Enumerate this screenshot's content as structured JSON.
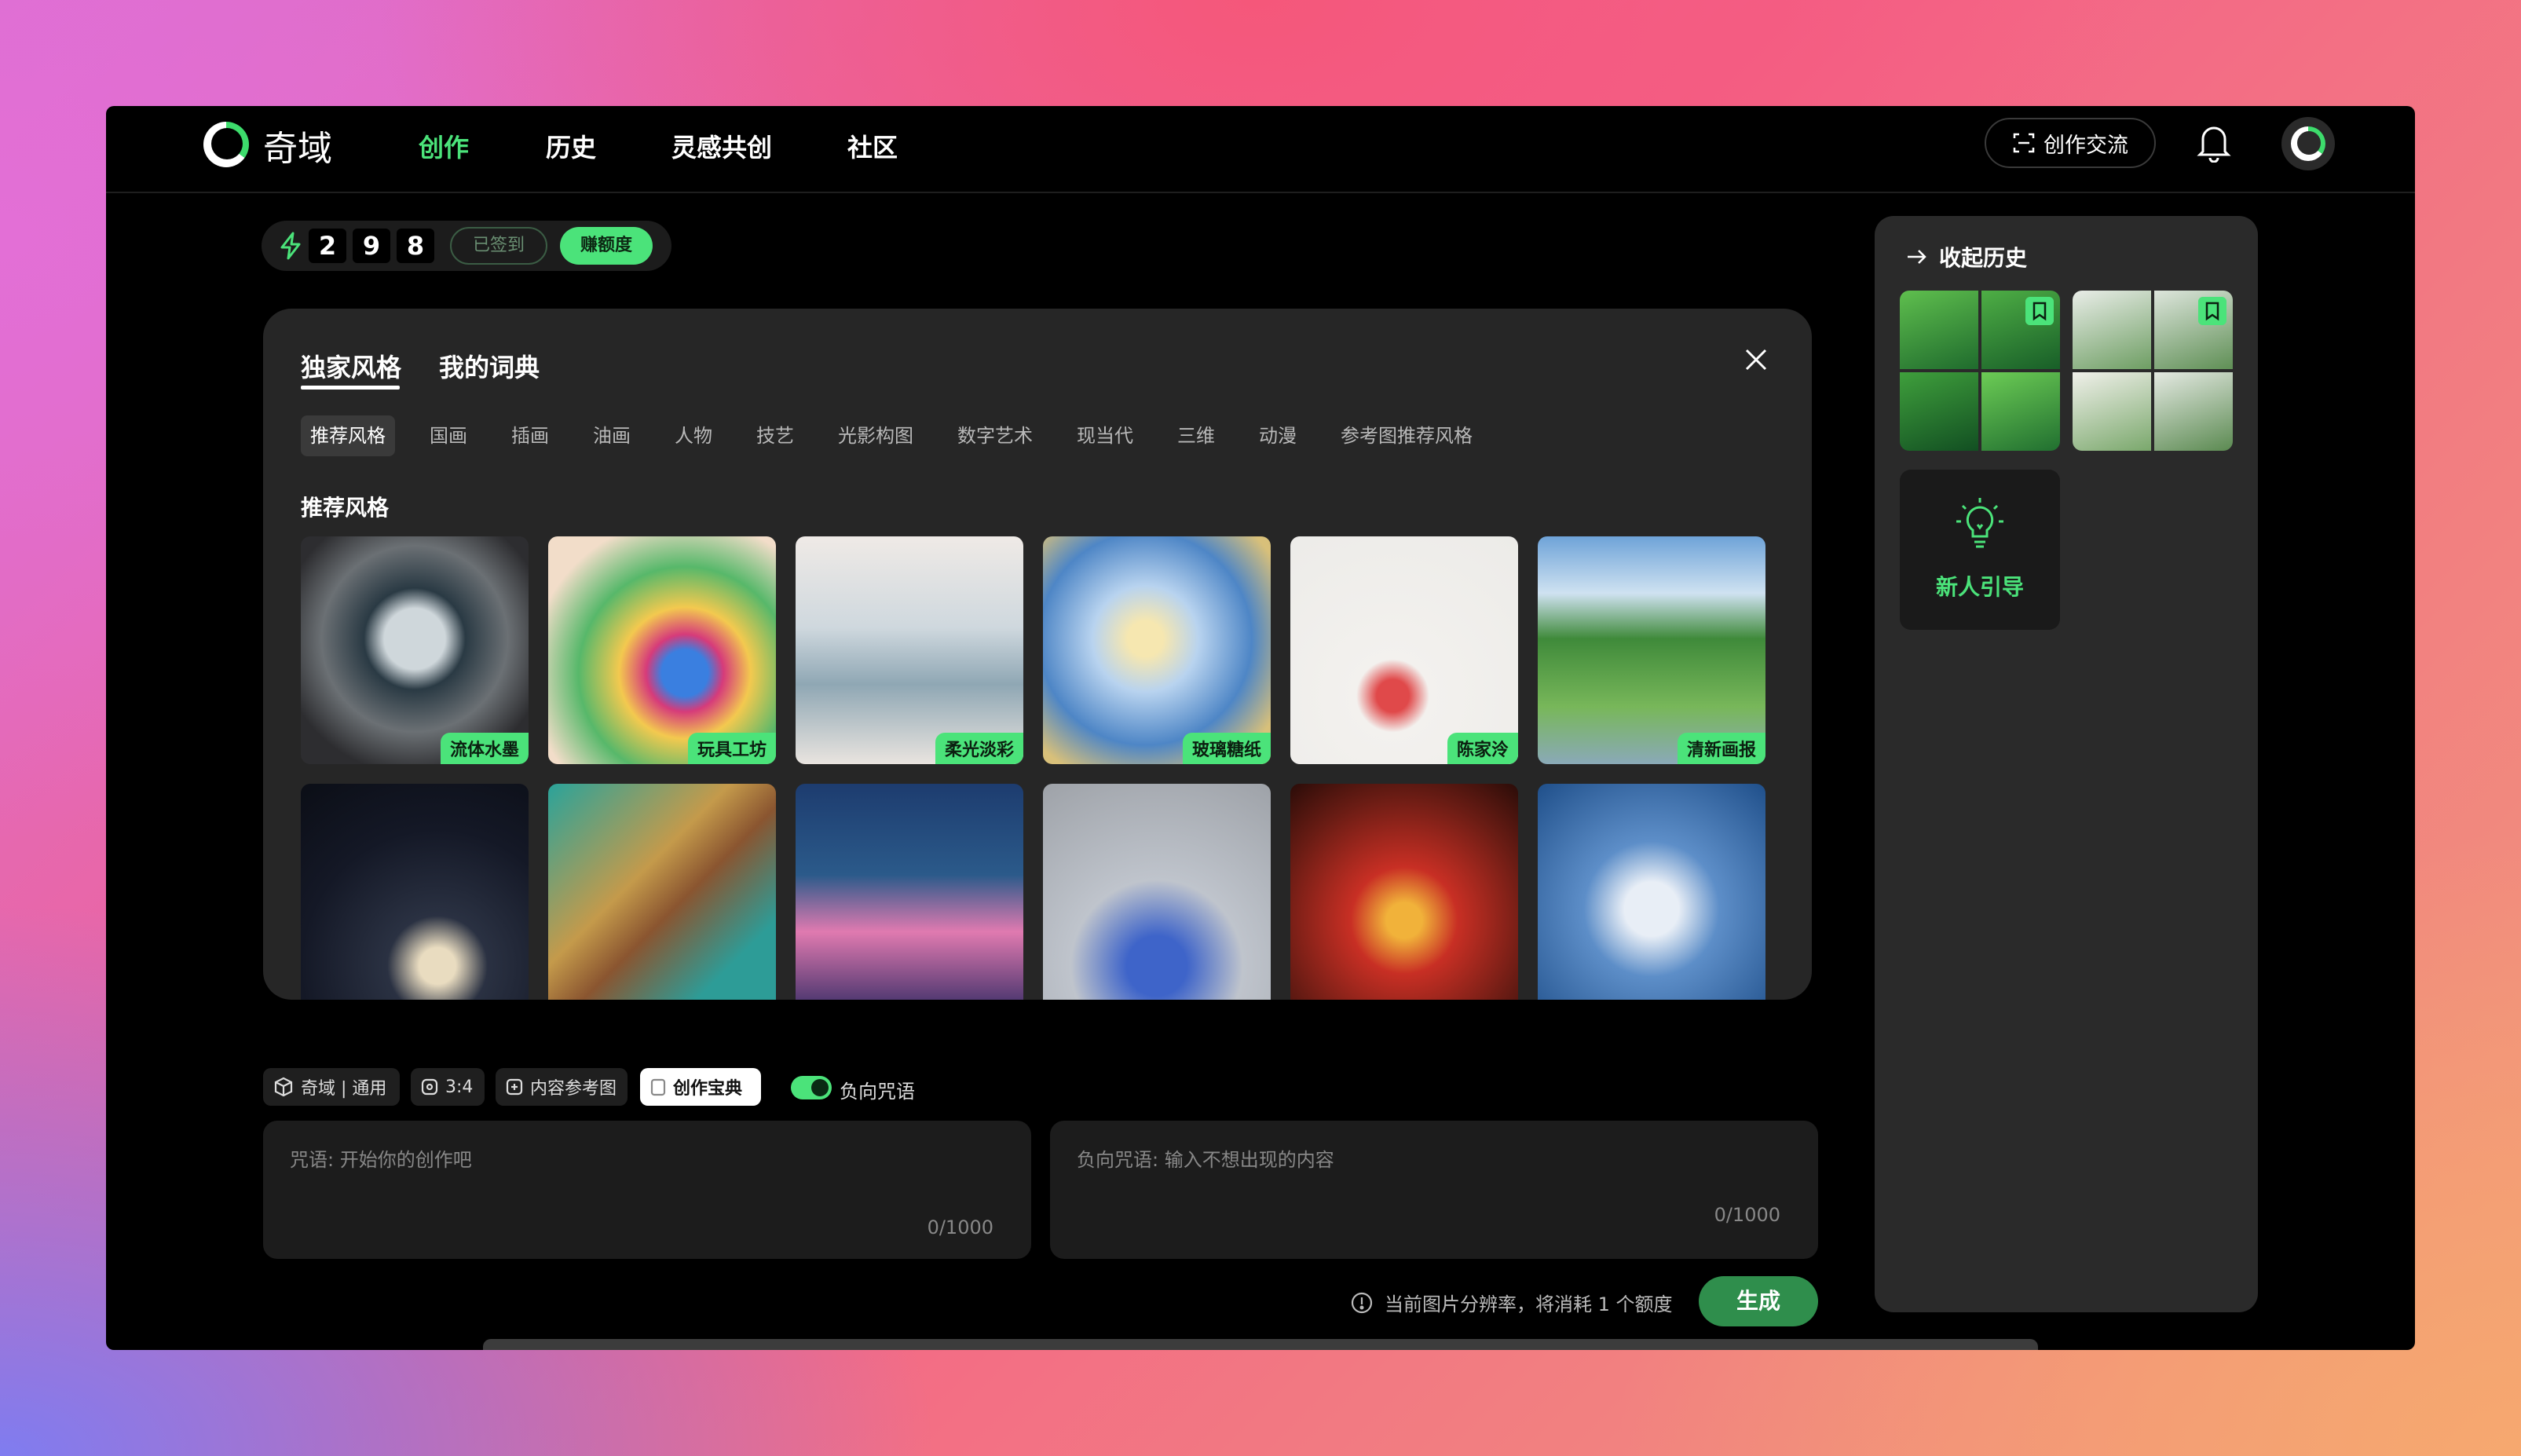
{
  "app": {
    "name": "奇域",
    "brand_color": "#4be37a"
  },
  "nav": {
    "items": [
      "创作",
      "历史",
      "灵感共创",
      "社区"
    ],
    "active": "创作"
  },
  "header": {
    "exchange_label": "创作交流"
  },
  "credits": {
    "digits": [
      "2",
      "9",
      "8"
    ],
    "signed_label": "已签到",
    "earn_label": "赚额度"
  },
  "style_panel": {
    "tabs": [
      "独家风格",
      "我的词典"
    ],
    "active_tab": "独家风格",
    "categories": [
      "推荐风格",
      "国画",
      "插画",
      "油画",
      "人物",
      "技艺",
      "光影构图",
      "数字艺术",
      "现当代",
      "三维",
      "动漫",
      "参考图推荐风格"
    ],
    "active_category": "推荐风格",
    "section_title": "推荐风格",
    "styles_row1": [
      "流体水墨",
      "玩具工坊",
      "柔光淡彩",
      "玻璃糖纸",
      "陈家泠",
      "清新画报"
    ]
  },
  "toolbar": {
    "model": "奇域 | 通用",
    "ratio": "3:4",
    "content_ref": "内容参考图",
    "handbook": "创作宝典",
    "negative_toggle": "负向咒语"
  },
  "prompt": {
    "placeholder": "咒语: 开始你的创作吧",
    "count": "0/1000"
  },
  "negative_prompt": {
    "placeholder": "负向咒语: 输入不想出现的内容",
    "count": "0/1000"
  },
  "footer": {
    "hint": "当前图片分辨率，将消耗 1 个额度",
    "generate_label": "生成"
  },
  "history_sidebar": {
    "collapse_label": "收起历史",
    "guide_label": "新人引导"
  }
}
